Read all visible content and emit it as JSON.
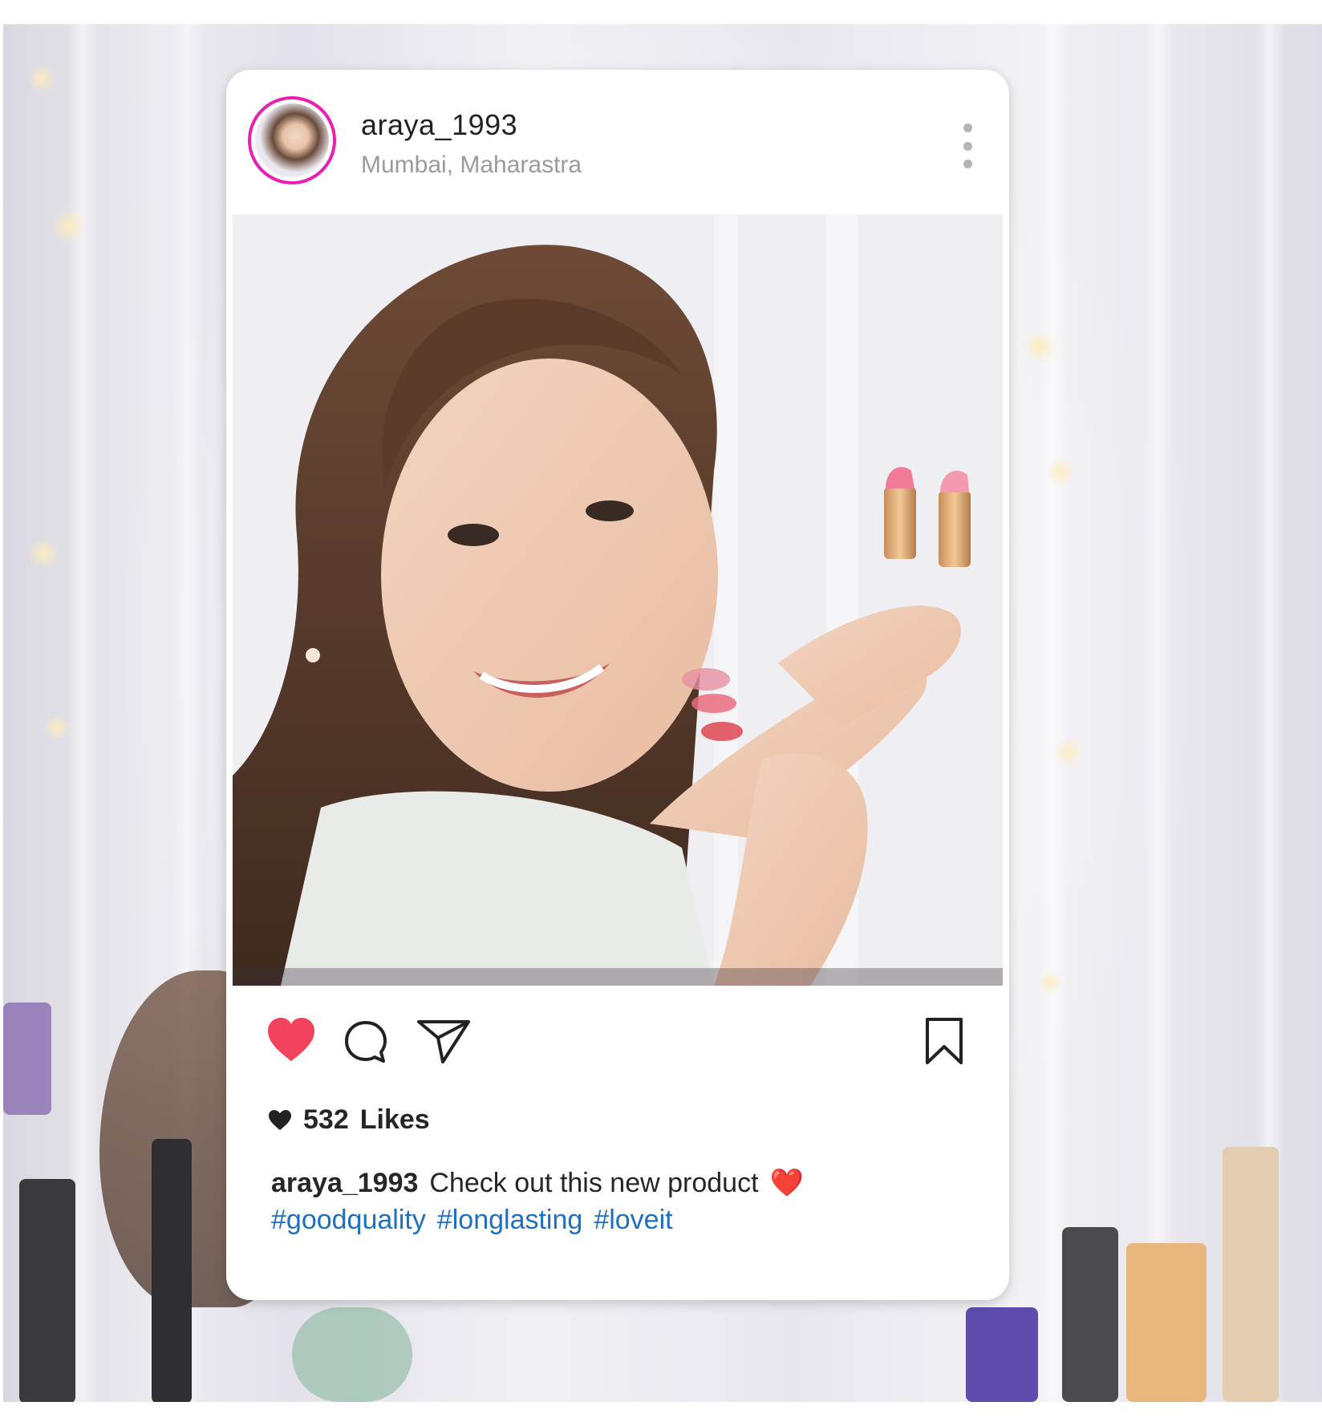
{
  "post": {
    "username": "araya_1993",
    "location": "Mumbai, Maharastra",
    "likes_count": "532",
    "likes_label": "Likes",
    "caption_user": "araya_1993",
    "caption_text": "Check out this new product",
    "caption_emoji": "❤️",
    "hashtags": [
      "#goodquality",
      "#longlasting",
      "#loveit"
    ]
  },
  "icons": {
    "like": "heart-icon",
    "comment": "comment-icon",
    "share": "send-icon",
    "save": "bookmark-icon",
    "more": "more-vertical-icon",
    "likes_heart": "heart-small-icon"
  },
  "colors": {
    "avatar_ring": "#e81fb1",
    "like_active": "#f2435c",
    "hashtag": "#1f6fc1"
  }
}
